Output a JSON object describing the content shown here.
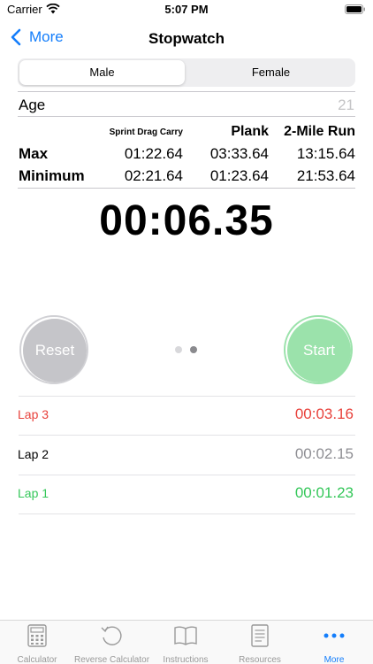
{
  "status": {
    "carrier": "Carrier",
    "time": "5:07 PM"
  },
  "nav": {
    "back_label": "More",
    "title": "Stopwatch"
  },
  "segments": {
    "male": "Male",
    "female": "Female",
    "selected": "Male"
  },
  "age": {
    "label": "Age",
    "value": "21"
  },
  "table": {
    "headers": [
      "Sprint Drag Carry",
      "Plank",
      "2-Mile Run"
    ],
    "rows": [
      {
        "label": "Max",
        "values": [
          "01:22.64",
          "03:33.64",
          "13:15.64"
        ]
      },
      {
        "label": "Minimum",
        "values": [
          "02:21.64",
          "01:23.64",
          "21:53.64"
        ]
      }
    ]
  },
  "timer": "00:06.35",
  "buttons": {
    "reset": "Reset",
    "start": "Start"
  },
  "pager": {
    "count": 2,
    "current": 2
  },
  "laps": [
    {
      "name": "Lap 3",
      "time": "00:03.16",
      "color": "#e8413b"
    },
    {
      "name": "Lap 2",
      "time": "00:02.15",
      "color": "#000000",
      "time_color": "#8e8e93"
    },
    {
      "name": "Lap 1",
      "time": "00:01.23",
      "color": "#34c759"
    }
  ],
  "tabs": [
    {
      "label": "Calculator",
      "icon": "calculator-icon"
    },
    {
      "label": "Reverse Calculator",
      "icon": "reverse-calculator-icon"
    },
    {
      "label": "Instructions",
      "icon": "book-icon"
    },
    {
      "label": "Resources",
      "icon": "document-icon"
    },
    {
      "label": "More",
      "icon": "more-icon",
      "active": true
    }
  ],
  "colors": {
    "accent": "#147efb",
    "start": "#9be2ab",
    "reset": "#c5c5c9"
  }
}
